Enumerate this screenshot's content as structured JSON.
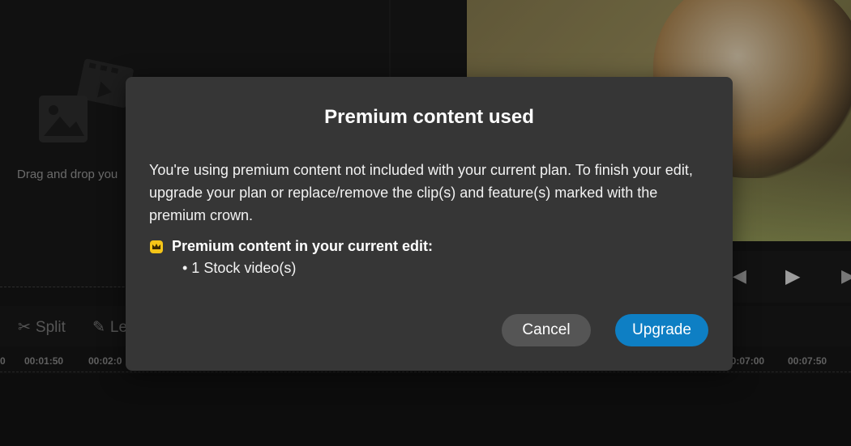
{
  "media": {
    "drop_text": "Drag and drop you"
  },
  "player": {
    "prev_icon": "◀",
    "play_icon": "▶",
    "next_icon": "▶"
  },
  "toolbar": {
    "split_label": "Split",
    "second_label": "Le"
  },
  "timeline": {
    "ticks": [
      "0",
      "00:01:50",
      "00:02:0",
      "00:07:00",
      "00:07:50"
    ]
  },
  "modal": {
    "title": "Premium content used",
    "body": "You're using premium content not included with your current plan. To finish your edit, upgrade your plan or replace/remove the clip(s) and feature(s) marked with the premium crown.",
    "premium_heading": "Premium content in your current edit:",
    "items": [
      "• 1 Stock video(s)"
    ],
    "cancel_label": "Cancel",
    "upgrade_label": "Upgrade"
  },
  "colors": {
    "accent": "#0e7fc4",
    "crown": "#f5c518",
    "modal_bg": "#363636"
  }
}
